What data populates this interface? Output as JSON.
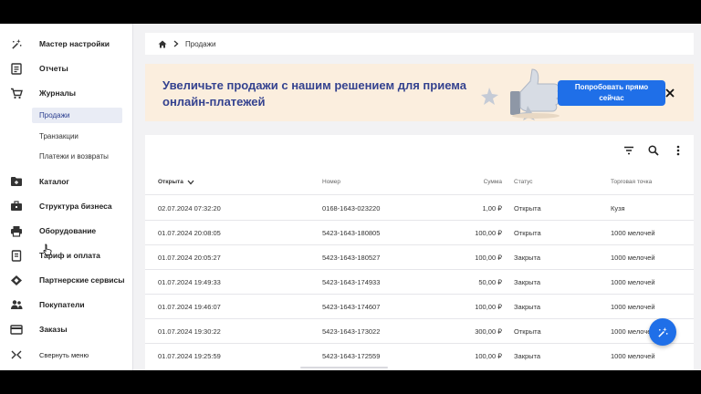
{
  "sidebar": {
    "items": [
      {
        "label": "Мастер настройки",
        "icon": "magic-wand-icon"
      },
      {
        "label": "Отчеты",
        "icon": "report-icon"
      },
      {
        "label": "Журналы",
        "icon": "cart-icon"
      },
      {
        "label": "Каталог",
        "icon": "folder-icon"
      },
      {
        "label": "Структура бизнеса",
        "icon": "briefcase-icon"
      },
      {
        "label": "Оборудование",
        "icon": "printer-icon"
      },
      {
        "label": "Тариф и оплата",
        "icon": "receipt-icon"
      },
      {
        "label": "Партнерские сервисы",
        "icon": "handshake-icon"
      },
      {
        "label": "Покупатели",
        "icon": "people-icon"
      },
      {
        "label": "Заказы",
        "icon": "card-icon"
      }
    ],
    "journal_sub": [
      "Продажи",
      "Транзакции",
      "Платежи и возвраты"
    ],
    "collapse_label": "Свернуть меню"
  },
  "breadcrumb": {
    "current": "Продажи"
  },
  "banner": {
    "text": "Увеличьте продажи с нашим решением для приема онлайн-платежей",
    "cta": "Попробовать прямо сейчас"
  },
  "table": {
    "columns": [
      "Открыта",
      "Номер",
      "Сумма",
      "Статус",
      "Торговая точка"
    ],
    "rows": [
      {
        "date": "02.07.2024 07:32:20",
        "number": "0168-1643-023220",
        "sum": "1,00 ₽",
        "status": "Открыта",
        "store": "Кузя"
      },
      {
        "date": "01.07.2024 20:08:05",
        "number": "5423-1643-180805",
        "sum": "100,00 ₽",
        "status": "Открыта",
        "store": "1000 мелочей"
      },
      {
        "date": "01.07.2024 20:05:27",
        "number": "5423-1643-180527",
        "sum": "100,00 ₽",
        "status": "Закрыта",
        "store": "1000 мелочей"
      },
      {
        "date": "01.07.2024 19:49:33",
        "number": "5423-1643-174933",
        "sum": "50,00 ₽",
        "status": "Закрыта",
        "store": "1000 мелочей"
      },
      {
        "date": "01.07.2024 19:46:07",
        "number": "5423-1643-174607",
        "sum": "100,00 ₽",
        "status": "Закрыта",
        "store": "1000 мелочей"
      },
      {
        "date": "01.07.2024 19:30:22",
        "number": "5423-1643-173022",
        "sum": "300,00 ₽",
        "status": "Открыта",
        "store": "1000 мелочей"
      },
      {
        "date": "01.07.2024 19:25:59",
        "number": "5423-1643-172559",
        "sum": "100,00 ₽",
        "status": "Закрыта",
        "store": "1000 мелочей"
      }
    ]
  },
  "colors": {
    "accent": "#1f6fe8",
    "banner_bg": "#fbeede",
    "banner_text": "#34428f",
    "active_bg": "#e9ecf5"
  }
}
